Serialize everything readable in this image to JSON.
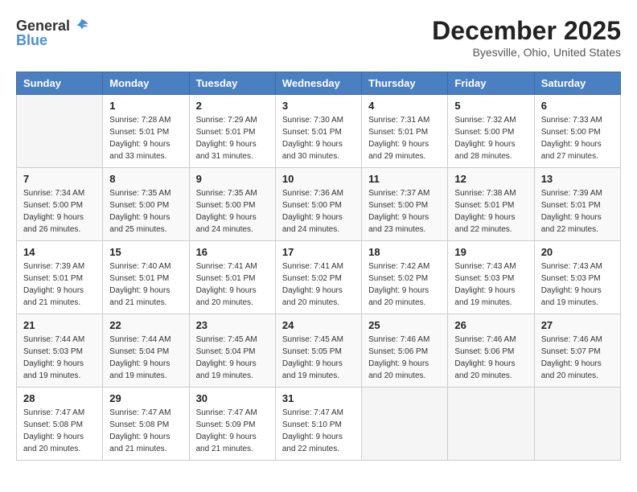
{
  "header": {
    "logo_general": "General",
    "logo_blue": "Blue",
    "month": "December 2025",
    "location": "Byesville, Ohio, United States"
  },
  "days_of_week": [
    "Sunday",
    "Monday",
    "Tuesday",
    "Wednesday",
    "Thursday",
    "Friday",
    "Saturday"
  ],
  "weeks": [
    [
      {
        "day": "",
        "sunrise": "",
        "sunset": "",
        "daylight": ""
      },
      {
        "day": "1",
        "sunrise": "Sunrise: 7:28 AM",
        "sunset": "Sunset: 5:01 PM",
        "daylight": "Daylight: 9 hours and 33 minutes."
      },
      {
        "day": "2",
        "sunrise": "Sunrise: 7:29 AM",
        "sunset": "Sunset: 5:01 PM",
        "daylight": "Daylight: 9 hours and 31 minutes."
      },
      {
        "day": "3",
        "sunrise": "Sunrise: 7:30 AM",
        "sunset": "Sunset: 5:01 PM",
        "daylight": "Daylight: 9 hours and 30 minutes."
      },
      {
        "day": "4",
        "sunrise": "Sunrise: 7:31 AM",
        "sunset": "Sunset: 5:01 PM",
        "daylight": "Daylight: 9 hours and 29 minutes."
      },
      {
        "day": "5",
        "sunrise": "Sunrise: 7:32 AM",
        "sunset": "Sunset: 5:00 PM",
        "daylight": "Daylight: 9 hours and 28 minutes."
      },
      {
        "day": "6",
        "sunrise": "Sunrise: 7:33 AM",
        "sunset": "Sunset: 5:00 PM",
        "daylight": "Daylight: 9 hours and 27 minutes."
      }
    ],
    [
      {
        "day": "7",
        "sunrise": "Sunrise: 7:34 AM",
        "sunset": "Sunset: 5:00 PM",
        "daylight": "Daylight: 9 hours and 26 minutes."
      },
      {
        "day": "8",
        "sunrise": "Sunrise: 7:35 AM",
        "sunset": "Sunset: 5:00 PM",
        "daylight": "Daylight: 9 hours and 25 minutes."
      },
      {
        "day": "9",
        "sunrise": "Sunrise: 7:35 AM",
        "sunset": "Sunset: 5:00 PM",
        "daylight": "Daylight: 9 hours and 24 minutes."
      },
      {
        "day": "10",
        "sunrise": "Sunrise: 7:36 AM",
        "sunset": "Sunset: 5:00 PM",
        "daylight": "Daylight: 9 hours and 24 minutes."
      },
      {
        "day": "11",
        "sunrise": "Sunrise: 7:37 AM",
        "sunset": "Sunset: 5:00 PM",
        "daylight": "Daylight: 9 hours and 23 minutes."
      },
      {
        "day": "12",
        "sunrise": "Sunrise: 7:38 AM",
        "sunset": "Sunset: 5:01 PM",
        "daylight": "Daylight: 9 hours and 22 minutes."
      },
      {
        "day": "13",
        "sunrise": "Sunrise: 7:39 AM",
        "sunset": "Sunset: 5:01 PM",
        "daylight": "Daylight: 9 hours and 22 minutes."
      }
    ],
    [
      {
        "day": "14",
        "sunrise": "Sunrise: 7:39 AM",
        "sunset": "Sunset: 5:01 PM",
        "daylight": "Daylight: 9 hours and 21 minutes."
      },
      {
        "day": "15",
        "sunrise": "Sunrise: 7:40 AM",
        "sunset": "Sunset: 5:01 PM",
        "daylight": "Daylight: 9 hours and 21 minutes."
      },
      {
        "day": "16",
        "sunrise": "Sunrise: 7:41 AM",
        "sunset": "Sunset: 5:01 PM",
        "daylight": "Daylight: 9 hours and 20 minutes."
      },
      {
        "day": "17",
        "sunrise": "Sunrise: 7:41 AM",
        "sunset": "Sunset: 5:02 PM",
        "daylight": "Daylight: 9 hours and 20 minutes."
      },
      {
        "day": "18",
        "sunrise": "Sunrise: 7:42 AM",
        "sunset": "Sunset: 5:02 PM",
        "daylight": "Daylight: 9 hours and 20 minutes."
      },
      {
        "day": "19",
        "sunrise": "Sunrise: 7:43 AM",
        "sunset": "Sunset: 5:03 PM",
        "daylight": "Daylight: 9 hours and 19 minutes."
      },
      {
        "day": "20",
        "sunrise": "Sunrise: 7:43 AM",
        "sunset": "Sunset: 5:03 PM",
        "daylight": "Daylight: 9 hours and 19 minutes."
      }
    ],
    [
      {
        "day": "21",
        "sunrise": "Sunrise: 7:44 AM",
        "sunset": "Sunset: 5:03 PM",
        "daylight": "Daylight: 9 hours and 19 minutes."
      },
      {
        "day": "22",
        "sunrise": "Sunrise: 7:44 AM",
        "sunset": "Sunset: 5:04 PM",
        "daylight": "Daylight: 9 hours and 19 minutes."
      },
      {
        "day": "23",
        "sunrise": "Sunrise: 7:45 AM",
        "sunset": "Sunset: 5:04 PM",
        "daylight": "Daylight: 9 hours and 19 minutes."
      },
      {
        "day": "24",
        "sunrise": "Sunrise: 7:45 AM",
        "sunset": "Sunset: 5:05 PM",
        "daylight": "Daylight: 9 hours and 19 minutes."
      },
      {
        "day": "25",
        "sunrise": "Sunrise: 7:46 AM",
        "sunset": "Sunset: 5:06 PM",
        "daylight": "Daylight: 9 hours and 20 minutes."
      },
      {
        "day": "26",
        "sunrise": "Sunrise: 7:46 AM",
        "sunset": "Sunset: 5:06 PM",
        "daylight": "Daylight: 9 hours and 20 minutes."
      },
      {
        "day": "27",
        "sunrise": "Sunrise: 7:46 AM",
        "sunset": "Sunset: 5:07 PM",
        "daylight": "Daylight: 9 hours and 20 minutes."
      }
    ],
    [
      {
        "day": "28",
        "sunrise": "Sunrise: 7:47 AM",
        "sunset": "Sunset: 5:08 PM",
        "daylight": "Daylight: 9 hours and 20 minutes."
      },
      {
        "day": "29",
        "sunrise": "Sunrise: 7:47 AM",
        "sunset": "Sunset: 5:08 PM",
        "daylight": "Daylight: 9 hours and 21 minutes."
      },
      {
        "day": "30",
        "sunrise": "Sunrise: 7:47 AM",
        "sunset": "Sunset: 5:09 PM",
        "daylight": "Daylight: 9 hours and 21 minutes."
      },
      {
        "day": "31",
        "sunrise": "Sunrise: 7:47 AM",
        "sunset": "Sunset: 5:10 PM",
        "daylight": "Daylight: 9 hours and 22 minutes."
      },
      {
        "day": "",
        "sunrise": "",
        "sunset": "",
        "daylight": ""
      },
      {
        "day": "",
        "sunrise": "",
        "sunset": "",
        "daylight": ""
      },
      {
        "day": "",
        "sunrise": "",
        "sunset": "",
        "daylight": ""
      }
    ]
  ]
}
